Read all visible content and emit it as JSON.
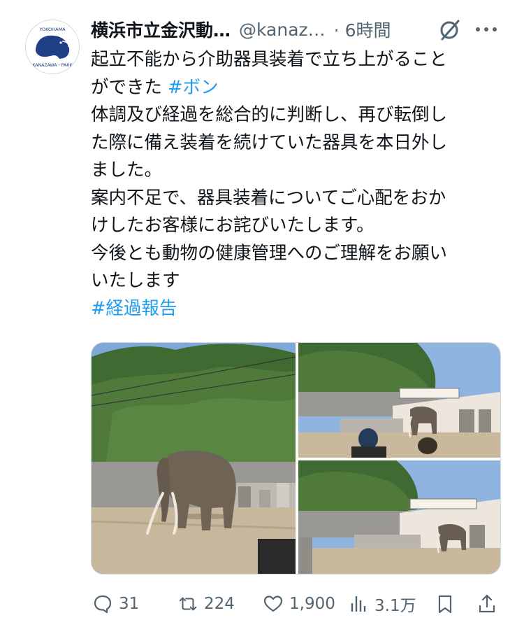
{
  "tweet": {
    "display_name": "横浜市立金沢動…",
    "handle": "@kanaz…",
    "time": "· 6時間",
    "avatar": {
      "icon": "kanazawa-park-logo",
      "text_top": "YOKOHAMA",
      "text_bottom": "KANAZAWA・PARK"
    },
    "lines": [
      {
        "text": "起立不能から介助器具装着で立ち上がること"
      },
      {
        "text": "ができた ",
        "hashtag": "#ボン"
      },
      {
        "text": "体調及び経過を総合的に判断し、再び転倒し"
      },
      {
        "text": "た際に備え装着を続けていた器具を本日外し"
      },
      {
        "text": "ました。"
      },
      {
        "text": "案内不足で、器具装着についてご心配をおか"
      },
      {
        "text": "けしたお客様にお詫びいたします。"
      },
      {
        "text": "今後とも動物の健康管理へのご理解をお願い"
      },
      {
        "text": "いたします"
      },
      {
        "text": "",
        "hashtag": "#経過報告"
      }
    ],
    "media": [
      {
        "icon": "photo-elephant-enclosure"
      },
      {
        "icon": "photo-elephant-visitors"
      },
      {
        "icon": "photo-elephant-building"
      }
    ]
  },
  "actions": {
    "reply": {
      "icon": "reply-icon",
      "count": "31"
    },
    "retweet": {
      "icon": "retweet-icon",
      "count": "224"
    },
    "like": {
      "icon": "heart-icon",
      "count": "1,900"
    },
    "views": {
      "icon": "views-icon",
      "count": "3.1万"
    },
    "bookmark": {
      "icon": "bookmark-icon"
    },
    "share": {
      "icon": "share-icon"
    }
  },
  "colors": {
    "text": "#0f1419",
    "secondary": "#536471",
    "link": "#1d9bf0",
    "border": "#cfd9de"
  }
}
